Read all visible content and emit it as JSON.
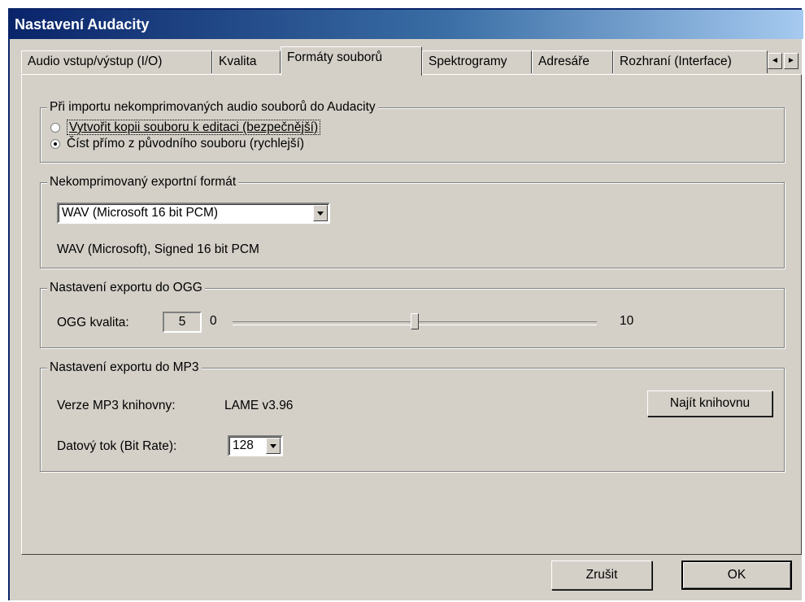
{
  "window": {
    "title": "Nastavení Audacity"
  },
  "tabs": [
    {
      "label": "Audio vstup/výstup (I/O)",
      "active": false
    },
    {
      "label": "Kvalita",
      "active": false
    },
    {
      "label": "Formáty souborů",
      "active": true
    },
    {
      "label": "Spektrogramy",
      "active": false
    },
    {
      "label": "Adresáře",
      "active": false
    },
    {
      "label": "Rozhraní (Interface)",
      "active": false
    }
  ],
  "import_group": {
    "legend": "Při importu nekomprimovaných audio souborů do Audacity",
    "options": [
      {
        "label": "Vytvořit kopii souboru k editaci (bezpečnější)",
        "checked": false
      },
      {
        "label": "Číst přímo z původního souboru (rychlejší)",
        "checked": true
      }
    ]
  },
  "export_format_group": {
    "legend": "Nekomprimovaný exportní formát",
    "selected": "WAV (Microsoft 16 bit PCM)",
    "description": "WAV (Microsoft), Signed 16 bit PCM"
  },
  "ogg_group": {
    "legend": "Nastavení exportu do OGG",
    "quality_label": "OGG kvalita:",
    "quality_value": "5",
    "min_label": "0",
    "max_label": "10",
    "slider_fraction": 0.5
  },
  "mp3_group": {
    "legend": "Nastavení exportu do MP3",
    "version_label": "Verze MP3 knihovny:",
    "version_value": "LAME v3.96",
    "find_button": "Najít knihovnu",
    "bitrate_label": "Datový tok (Bit Rate):",
    "bitrate_value": "128"
  },
  "footer": {
    "cancel": "Zrušit",
    "ok": "OK"
  },
  "icons": {
    "tab_scroll_left": "◄",
    "tab_scroll_right": "►"
  }
}
